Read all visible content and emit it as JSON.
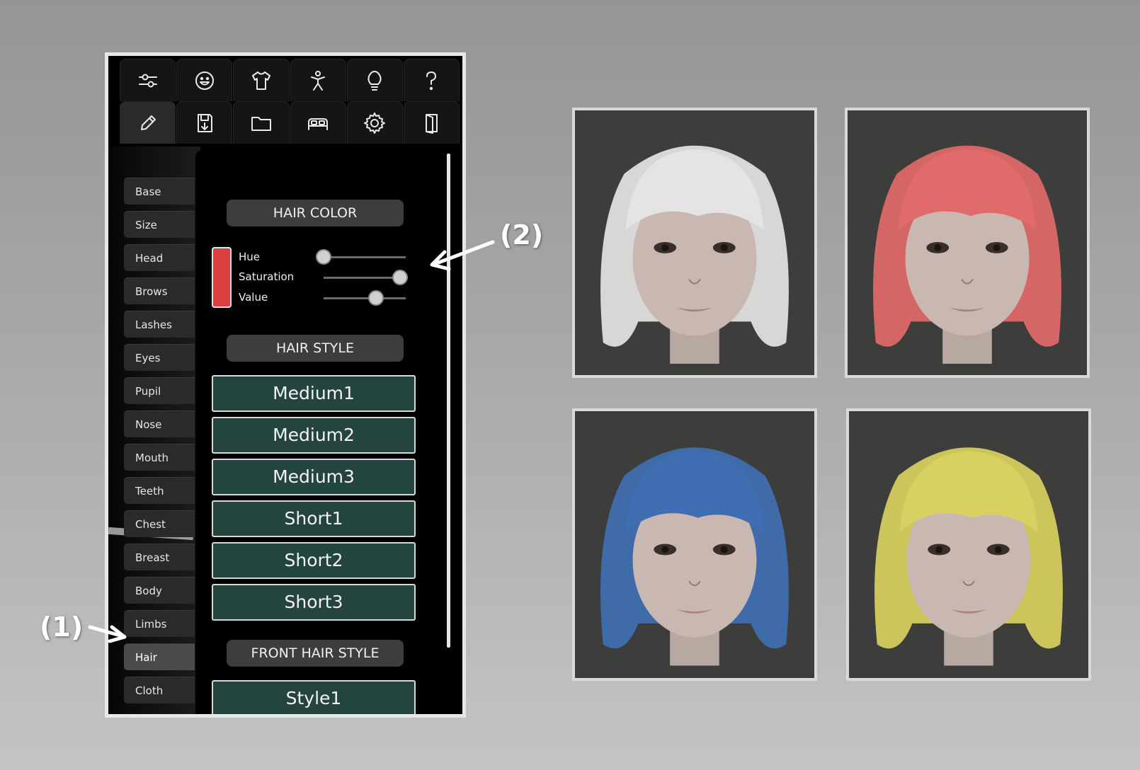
{
  "toolbar": {
    "row1": [
      "sliders-icon",
      "smiley-icon",
      "tshirt-icon",
      "person-icon",
      "lightbulb-icon",
      "help-icon"
    ],
    "row2": [
      "pencil-icon",
      "save-icon",
      "folder-icon",
      "bed-icon",
      "gear-icon",
      "door-icon"
    ]
  },
  "categories": [
    "Base",
    "Size",
    "Head",
    "Brows",
    "Lashes",
    "Eyes",
    "Pupil",
    "Nose",
    "Mouth",
    "Teeth",
    "Chest",
    "Breast",
    "Body",
    "Limbs",
    "Hair",
    "Cloth"
  ],
  "selected_category": "Hair",
  "hair_color": {
    "title": "HAIR COLOR",
    "swatch_color": "#dc3d3d",
    "sliders": [
      {
        "label": "Hue",
        "value": 0.0
      },
      {
        "label": "Saturation",
        "value": 0.93
      },
      {
        "label": "Value",
        "value": 0.64
      }
    ]
  },
  "hair_style": {
    "title": "HAIR STYLE",
    "options": [
      "Medium1",
      "Medium2",
      "Medium3",
      "Short1",
      "Short2",
      "Short3"
    ]
  },
  "front_hair_style": {
    "title": "FRONT HAIR STYLE",
    "options": [
      "Style1"
    ]
  },
  "callouts": {
    "one": "(1)",
    "two": "(2)"
  },
  "previews": [
    {
      "hair_color": "#e4e4e4"
    },
    {
      "hair_color": "#e16a6a"
    },
    {
      "hair_color": "#3f6fb2"
    },
    {
      "hair_color": "#d8d060"
    }
  ]
}
